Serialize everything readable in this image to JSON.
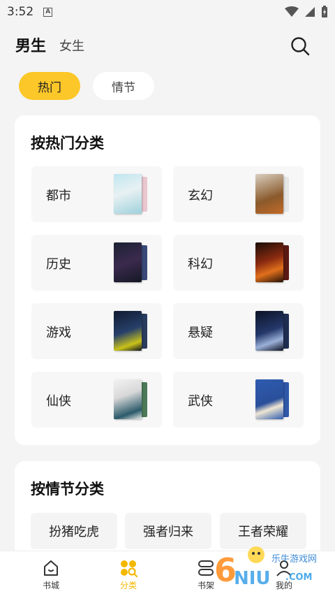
{
  "status": {
    "time": "3:52",
    "notif_icon": "A"
  },
  "header": {
    "tab_male": "男生",
    "tab_female": "女生"
  },
  "filters": {
    "hot": "热门",
    "plot": "情节"
  },
  "hot_section": {
    "title": "按热门分类",
    "categories": [
      {
        "name": "都市"
      },
      {
        "name": "玄幻"
      },
      {
        "name": "历史"
      },
      {
        "name": "科幻"
      },
      {
        "name": "游戏"
      },
      {
        "name": "悬疑"
      },
      {
        "name": "仙侠"
      },
      {
        "name": "武侠"
      }
    ]
  },
  "plot_section": {
    "title": "按情节分类",
    "tags": [
      "扮猪吃虎",
      "强者归来",
      "王者荣耀"
    ]
  },
  "nav": {
    "items": [
      "书城",
      "分类",
      "书架",
      "我的"
    ],
    "active_color": "#f3b800"
  },
  "watermark": {
    "text": "乐牛游戏网",
    "domain": ".COM",
    "num": "6NIU"
  },
  "colors": {
    "accent": "#fcc728"
  }
}
